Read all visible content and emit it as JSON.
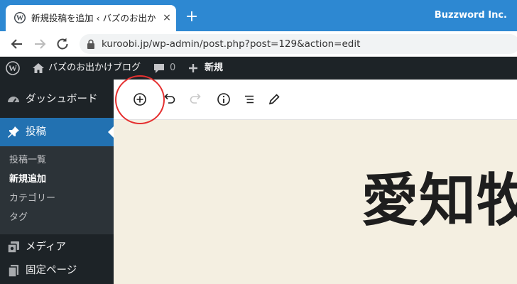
{
  "browser": {
    "tab_title": "新規投稿を追加 ‹ バズのお出かけブロ",
    "tab_close": "×",
    "new_tab": "+",
    "profile": "Buzzword Inc.",
    "url": "kuroobi.jp/wp-admin/post.php?post=129&action=edit"
  },
  "adminbar": {
    "site_name": "バズのお出かけブログ",
    "comments_count": "0",
    "new_label": "新規"
  },
  "sidebar": {
    "dashboard": "ダッシュボード",
    "posts": "投稿",
    "submenu": [
      "投稿一覧",
      "新規追加",
      "カテゴリー",
      "タグ"
    ],
    "media": "メディア",
    "pages": "固定ページ"
  },
  "editor": {
    "post_title": "愛知牧"
  },
  "colors": {
    "tabbar": "#2d88d2",
    "admin_dark": "#1d2327",
    "active_blue": "#2271b1",
    "canvas_bg": "#f4efe1",
    "highlight": "#e53030"
  }
}
